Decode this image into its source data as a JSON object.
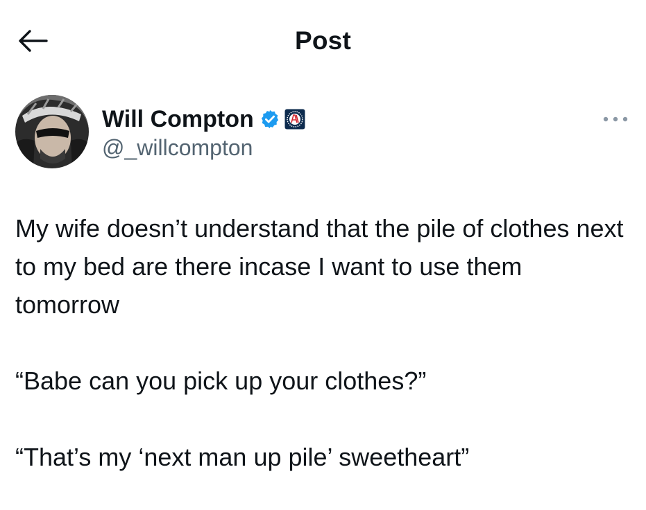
{
  "header": {
    "title": "Post",
    "back_icon": "arrow-left-icon"
  },
  "author": {
    "display_name": "Will Compton",
    "handle": "@_willcompton",
    "verified_icon": "verified-badge-icon",
    "verified_color": "#1d9bf0",
    "affiliate_icon": "barstool-affiliate-badge-icon",
    "more_icon": "more-horizontal-icon"
  },
  "tweet": {
    "paragraphs": [
      "My wife doesn’t understand that the pile of clothes next to my bed are there incase I want to use them tomorrow",
      "“Babe can you pick up your clothes?”",
      "“That’s my ‘next man up pile’ sweetheart”"
    ]
  },
  "colors": {
    "text_primary": "#0f1419",
    "text_secondary": "#536471",
    "background": "#ffffff"
  }
}
